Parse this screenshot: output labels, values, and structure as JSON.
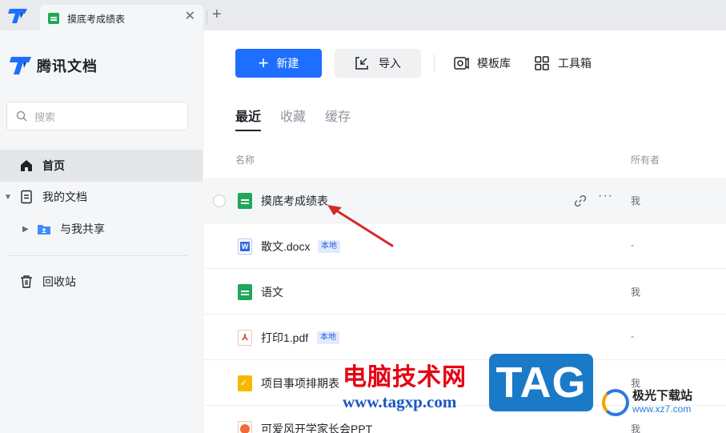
{
  "tabbar": {
    "tab_title": "摸底考成绩表",
    "close_glyph": "✕",
    "add_glyph": "+"
  },
  "sidebar": {
    "brand": "腾讯文档",
    "search_placeholder": "搜索",
    "nav": {
      "home": "首页",
      "my_docs": "我的文档",
      "shared": "与我共享",
      "trash": "回收站"
    }
  },
  "toolbar": {
    "new_label": "新建",
    "import_label": "导入",
    "template_label": "模板库",
    "toolbox_label": "工具箱"
  },
  "subtabs": [
    "最近",
    "收藏",
    "缓存"
  ],
  "table": {
    "col_name": "名称",
    "col_owner": "所有者",
    "rows": [
      {
        "name": "摸底考成绩表",
        "icon": "sheet-icon",
        "owner": "我",
        "badge": ""
      },
      {
        "name": "散文.docx",
        "icon": "word-icon",
        "owner": "-",
        "badge": "本地"
      },
      {
        "name": "语文",
        "icon": "sheet-icon",
        "owner": "我",
        "badge": ""
      },
      {
        "name": "打印1.pdf",
        "icon": "pdf-icon",
        "owner": "-",
        "badge": "本地"
      },
      {
        "name": "项目事项排期表",
        "icon": "task-icon",
        "owner": "我",
        "badge": ""
      },
      {
        "name": "可爱风开学家长会PPT",
        "icon": "ppt-icon",
        "owner": "我",
        "badge": ""
      }
    ]
  },
  "watermark": {
    "text": "电脑技术网",
    "url": "www.tagxp.com",
    "tag": "TAG",
    "site2_name": "极光下载站",
    "site2_url": "www.xz7.com"
  },
  "colors": {
    "accent": "#1e6fff",
    "sheet_green": "#1fa75a",
    "arrow_red": "#d42a2a"
  }
}
